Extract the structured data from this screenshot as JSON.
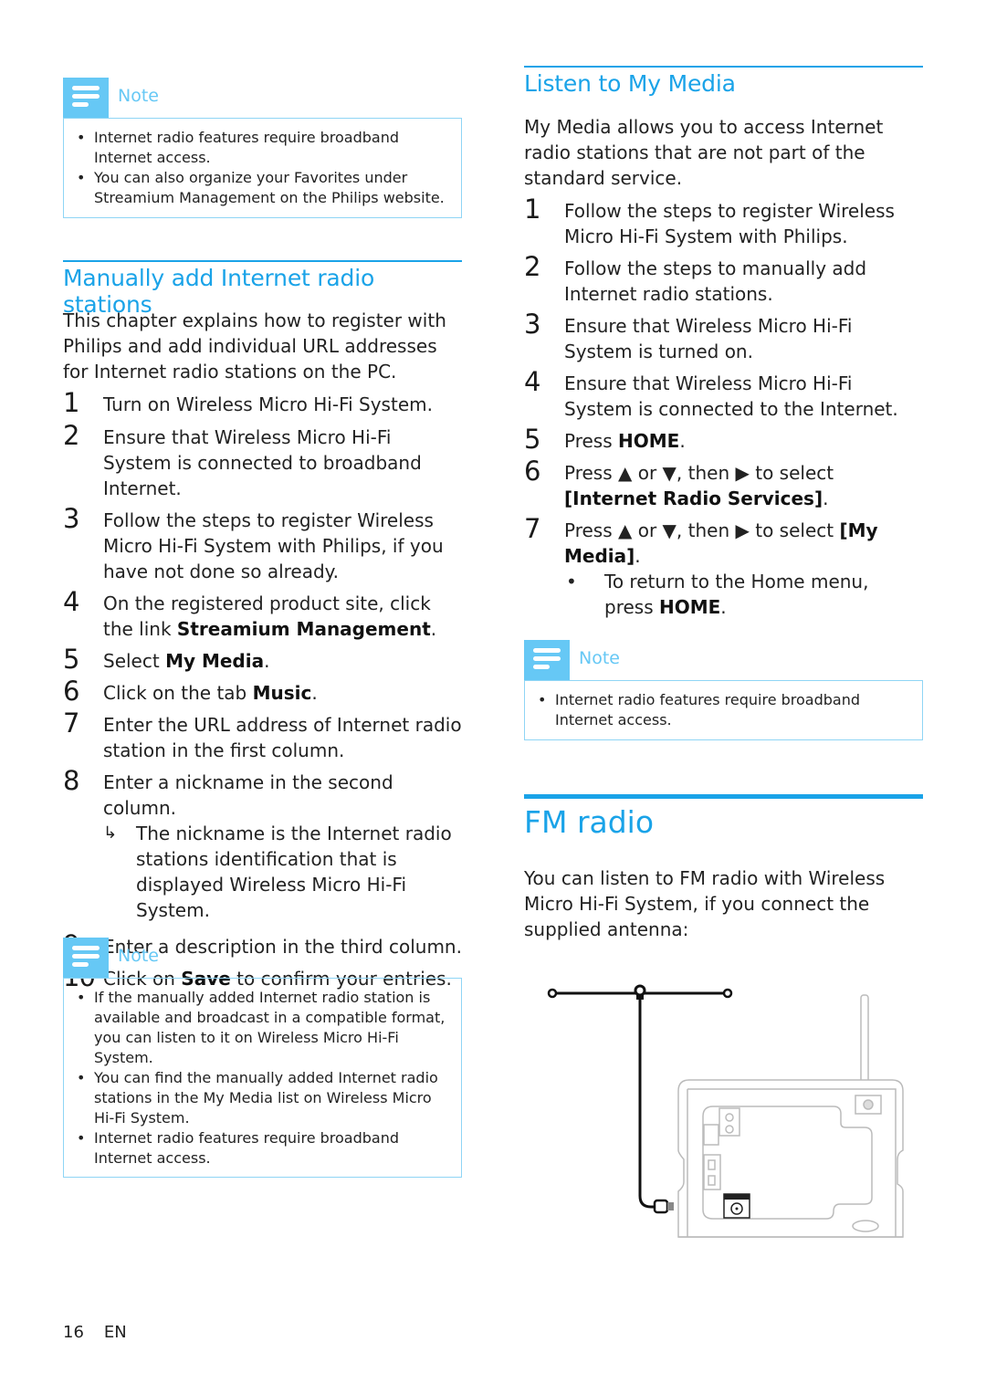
{
  "left": {
    "note1": {
      "label": "Note",
      "items": [
        "Internet radio features require broadband Internet access.",
        "You can also organize your Favorites under Streamium Management on the Philips website."
      ]
    },
    "section": {
      "title": "Manually add Internet radio stations",
      "intro": "This chapter explains how to register with Philips and add individual URL addresses for Internet radio stations on the PC.",
      "steps": [
        {
          "num": "1",
          "pre": "Turn on Wireless Micro Hi-Fi System.",
          "bold": "",
          "post": ""
        },
        {
          "num": "2",
          "pre": "Ensure that Wireless Micro Hi-Fi System is connected to broadband Internet.",
          "bold": "",
          "post": ""
        },
        {
          "num": "3",
          "pre": "Follow the steps to register Wireless Micro Hi-Fi System with Philips, if you have not done so already.",
          "bold": "",
          "post": ""
        },
        {
          "num": "4",
          "pre": "On the registered product site, click the link ",
          "bold": "Streamium Management",
          "post": "."
        },
        {
          "num": "5",
          "pre": "Select ",
          "bold": "My Media",
          "post": "."
        },
        {
          "num": "6",
          "pre": "Click on the tab ",
          "bold": "Music",
          "post": "."
        },
        {
          "num": "7",
          "pre": "Enter the URL address of Internet radio station in the first column.",
          "bold": "",
          "post": ""
        },
        {
          "num": "8",
          "pre": "Enter a nickname in the second column.",
          "bold": "",
          "post": "",
          "result": "The nickname is the Internet radio stations identification that is displayed Wireless Micro Hi-Fi System."
        },
        {
          "num": "9",
          "pre": "Enter a description in the third column.",
          "bold": "",
          "post": ""
        },
        {
          "num": "10",
          "pre": "Click on ",
          "bold": "Save",
          "post": " to confirm your entries."
        }
      ],
      "result_arrow": "↳"
    },
    "note2": {
      "label": "Note",
      "items": [
        "If the manually added Internet radio station is available and broadcast in a compatible format, you can listen to it on Wireless Micro Hi-Fi System.",
        "You can find the manually added Internet radio stations in the My Media list on Wireless Micro Hi-Fi System.",
        "Internet radio features require broadband Internet access."
      ]
    }
  },
  "right": {
    "section": {
      "title": "Listen to My Media",
      "intro": "My Media allows you to access Internet radio stations that are not part of the standard service.",
      "steps": [
        {
          "num": "1",
          "text": "Follow the steps to register Wireless Micro Hi-Fi System with Philips."
        },
        {
          "num": "2",
          "text": "Follow the steps to manually add Internet radio stations."
        },
        {
          "num": "3",
          "text": "Ensure that Wireless Micro Hi-Fi System is turned on."
        },
        {
          "num": "4",
          "text": "Ensure that Wireless Micro Hi-Fi System is connected to the Internet."
        },
        {
          "num": "5",
          "pre": "Press ",
          "bold": "HOME",
          "post": "."
        },
        {
          "num": "6",
          "pre": "Press ▲ or ▼, then ▶ to select ",
          "bold": "[Internet Radio Services]",
          "post": "."
        },
        {
          "num": "7",
          "pre": "Press ▲ or ▼, then ▶ to select ",
          "bold": "[My Media]",
          "post": ".",
          "sub_pre": "To return to the Home menu, press ",
          "sub_bold": "HOME",
          "sub_post": "."
        }
      ]
    },
    "note": {
      "label": "Note",
      "items": [
        "Internet radio features require broadband Internet access."
      ]
    },
    "fm": {
      "title": "FM radio",
      "intro": "You can listen to FM radio with Wireless Micro Hi-Fi System, if you connect the supplied antenna:",
      "figure_accent": "#1aa3e8"
    }
  },
  "footer": {
    "page": "16",
    "lang": "EN"
  },
  "colors": {
    "accent": "#1aa3e8",
    "note": "#66c8f5",
    "text": "#222222"
  }
}
